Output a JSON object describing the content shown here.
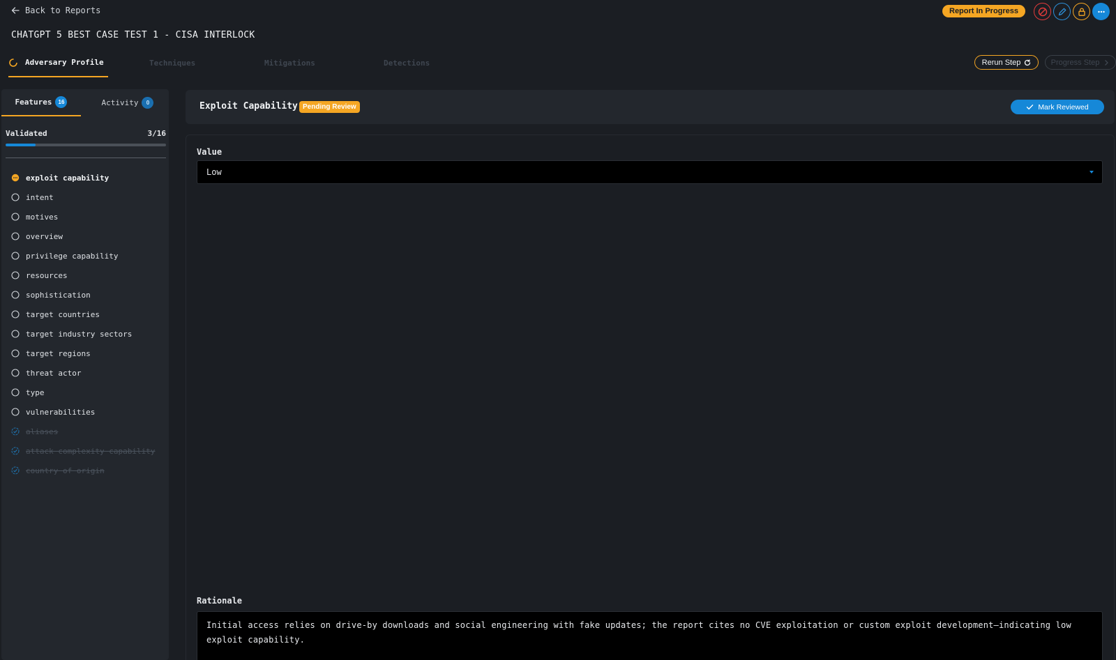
{
  "header": {
    "back_label": "Back to Reports",
    "report_title": "CHATGPT 5 BEST CASE TEST 1 - CISA INTERLOCK",
    "status": "Report In Progress",
    "icons": [
      "block-icon",
      "edit-icon",
      "lock-icon",
      "more-icon"
    ]
  },
  "steps": {
    "tabs": [
      {
        "label": "Adversary Profile",
        "state": "active"
      },
      {
        "label": "Techniques",
        "state": "disabled"
      },
      {
        "label": "Mitigations",
        "state": "disabled"
      },
      {
        "label": "Detections",
        "state": "disabled"
      }
    ],
    "rerun_label": "Rerun Step",
    "progress_label": "Progress Step"
  },
  "sidebar": {
    "tabs": [
      {
        "label": "Features",
        "count": "16"
      },
      {
        "label": "Activity",
        "count": "0"
      }
    ],
    "validated_label": "Validated",
    "validated_count": "3/16",
    "validated_fraction": 0.1875,
    "features": [
      {
        "label": "exploit capability",
        "state": "current"
      },
      {
        "label": "intent",
        "state": "todo"
      },
      {
        "label": "motives",
        "state": "todo"
      },
      {
        "label": "overview",
        "state": "todo"
      },
      {
        "label": "privilege capability",
        "state": "todo"
      },
      {
        "label": "resources",
        "state": "todo"
      },
      {
        "label": "sophistication",
        "state": "todo"
      },
      {
        "label": "target countries",
        "state": "todo"
      },
      {
        "label": "target industry sectors",
        "state": "todo"
      },
      {
        "label": "target regions",
        "state": "todo"
      },
      {
        "label": "threat actor",
        "state": "todo"
      },
      {
        "label": "type",
        "state": "todo"
      },
      {
        "label": "vulnerabilities",
        "state": "todo"
      },
      {
        "label": "aliases",
        "state": "done"
      },
      {
        "label": "attack complexity capability",
        "state": "done"
      },
      {
        "label": "country of origin",
        "state": "done"
      }
    ]
  },
  "main": {
    "feature_title": "Exploit Capability",
    "review_status": "Pending Review",
    "mark_reviewed_label": "Mark Reviewed",
    "value_label": "Value",
    "value": "Low",
    "rationale_label": "Rationale",
    "rationale": "Initial access relies on drive-by downloads and social engineering with fake updates; the report cites no CVE exploitation or custom exploit development—indicating low exploit capability."
  },
  "colors": {
    "accent_orange": "#f5a623",
    "accent_blue": "#1688d8",
    "danger_red": "#e23b3b",
    "background": "#1b1e23",
    "panel": "#23272d"
  }
}
